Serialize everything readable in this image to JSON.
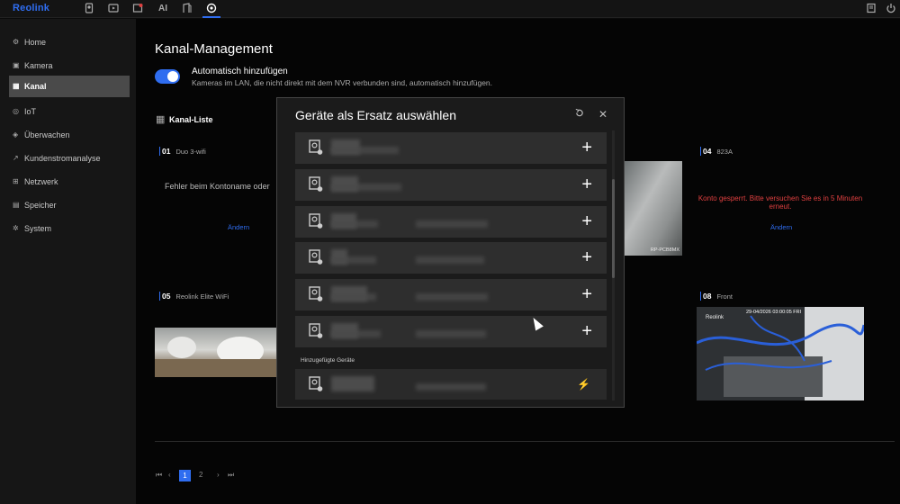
{
  "brand": {
    "logo": "Reolink",
    "accent": "#2f6df0"
  },
  "topbar": {
    "icons": [
      "phone-camera-icon",
      "playback-icon",
      "alarm-icon",
      "ai-icon",
      "door-icon",
      "settings-icon",
      "notes-icon",
      "power-icon"
    ],
    "ai_label": "AI"
  },
  "sidebar": {
    "items": [
      {
        "label": "Home",
        "icon": "home-icon"
      },
      {
        "label": "Kamera",
        "icon": "camera-icon"
      },
      {
        "label": "Kanal",
        "icon": "grid-icon",
        "active": true
      },
      {
        "label": "IoT",
        "icon": "iot-icon"
      },
      {
        "label": "Überwachen",
        "icon": "shield-icon"
      },
      {
        "label": "Kundenstromanalyse",
        "icon": "chart-icon"
      },
      {
        "label": "Netzwerk",
        "icon": "network-icon"
      },
      {
        "label": "Speicher",
        "icon": "storage-icon"
      },
      {
        "label": "System",
        "icon": "gear-icon"
      }
    ]
  },
  "main": {
    "title": "Kanal-Management",
    "auto_add": {
      "title": "Automatisch hinzufügen",
      "desc": "Kameras im LAN, die nicht direkt mit dem NVR verbunden sind, automatisch hinzufügen.",
      "enabled": true
    },
    "list_title": "Kanal-Liste",
    "channels": {
      "c01": {
        "num": "01",
        "name": "Duo 3-wifi",
        "error": "Fehler beim Kontoname oder",
        "link": "Ändern"
      },
      "c04": {
        "num": "04",
        "name": "823A",
        "error": "Konto gesperrt. Bitte versuchen Sie es in 5 Minuten erneut.",
        "link": "Ändern"
      },
      "c05": {
        "num": "05",
        "name": "Reolink Elite WiFi"
      },
      "c08": {
        "num": "08",
        "name": "Front",
        "osd": "29-04/2026 03:00:05 FRI",
        "brand": "Reolink"
      },
      "c_mid": {
        "tag": "RP-PCB8MX"
      }
    },
    "pagination": {
      "first": "⏮",
      "prev": "‹",
      "pages": [
        "1",
        "2"
      ],
      "current": "1",
      "next": "›",
      "last": "⏭"
    }
  },
  "modal": {
    "title": "Geräte als Ersatz auswählen",
    "refresh_icon": "refresh-icon",
    "close_icon": "close-icon",
    "add_symbol": "+",
    "section_added": "Hinzugefügte Geräte",
    "device_rows": 6,
    "added_rows": 1
  }
}
